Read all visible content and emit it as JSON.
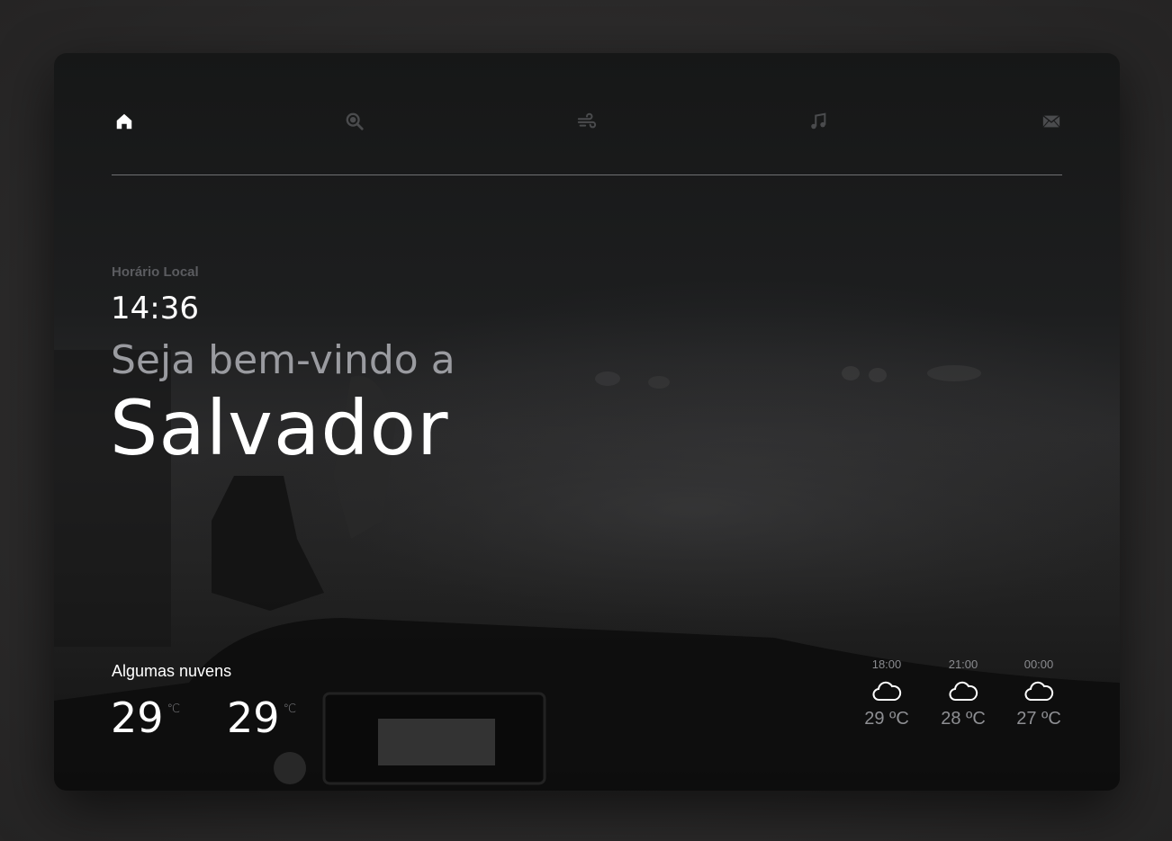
{
  "nav": {
    "items": [
      {
        "icon": "home-icon",
        "active": true
      },
      {
        "icon": "search-icon",
        "active": false
      },
      {
        "icon": "wind-icon",
        "active": false
      },
      {
        "icon": "music-icon",
        "active": false
      },
      {
        "icon": "mail-icon",
        "active": false
      }
    ]
  },
  "clock": {
    "label": "Horário Local",
    "time": "14:36"
  },
  "greeting": {
    "welcome": "Seja bem-vindo a",
    "city": "Salvador"
  },
  "weather": {
    "condition": "Algumas nuvens",
    "temp_now": "29",
    "temp_feel": "29",
    "unit": "℃"
  },
  "forecast": [
    {
      "time": "18:00",
      "icon": "cloud-icon",
      "temp": "29 ºC"
    },
    {
      "time": "21:00",
      "icon": "cloud-icon",
      "temp": "28 ºC"
    },
    {
      "time": "00:00",
      "icon": "cloud-icon",
      "temp": "27 ºC"
    }
  ],
  "colors": {
    "active_icon": "#ffffff",
    "inactive_icon": "#4a4b4d",
    "muted_text": "#9a9ba0",
    "label_text": "#5b5c60"
  }
}
